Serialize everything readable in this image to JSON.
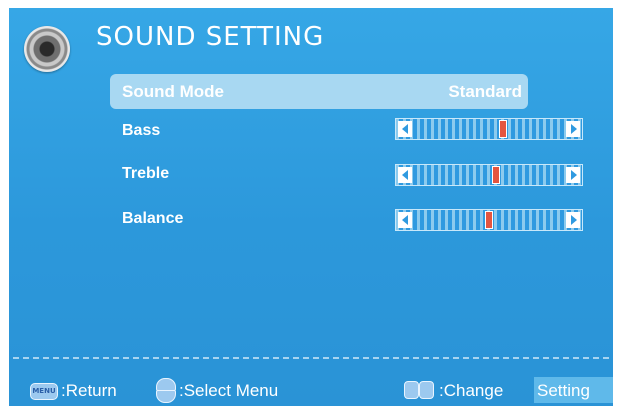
{
  "header": {
    "title": "SOUND SETTING",
    "icon": "speaker-icon"
  },
  "menu": {
    "sound_mode": {
      "label": "Sound Mode",
      "value": "Standard"
    },
    "bass": {
      "label": "Bass",
      "level": 0.6
    },
    "treble": {
      "label": "Treble",
      "level": 0.55
    },
    "balance": {
      "label": "Balance",
      "level": 0.5
    }
  },
  "footer": {
    "menu_key": "MENU",
    "return_label": ":Return",
    "select_label": ":Select Menu",
    "change_label": ":Change",
    "setting_label": "Setting"
  },
  "colors": {
    "background": "#2c98db",
    "highlight_row": "#a8d8f2",
    "slider_thumb": "#e4553f",
    "text": "#ffffff"
  }
}
